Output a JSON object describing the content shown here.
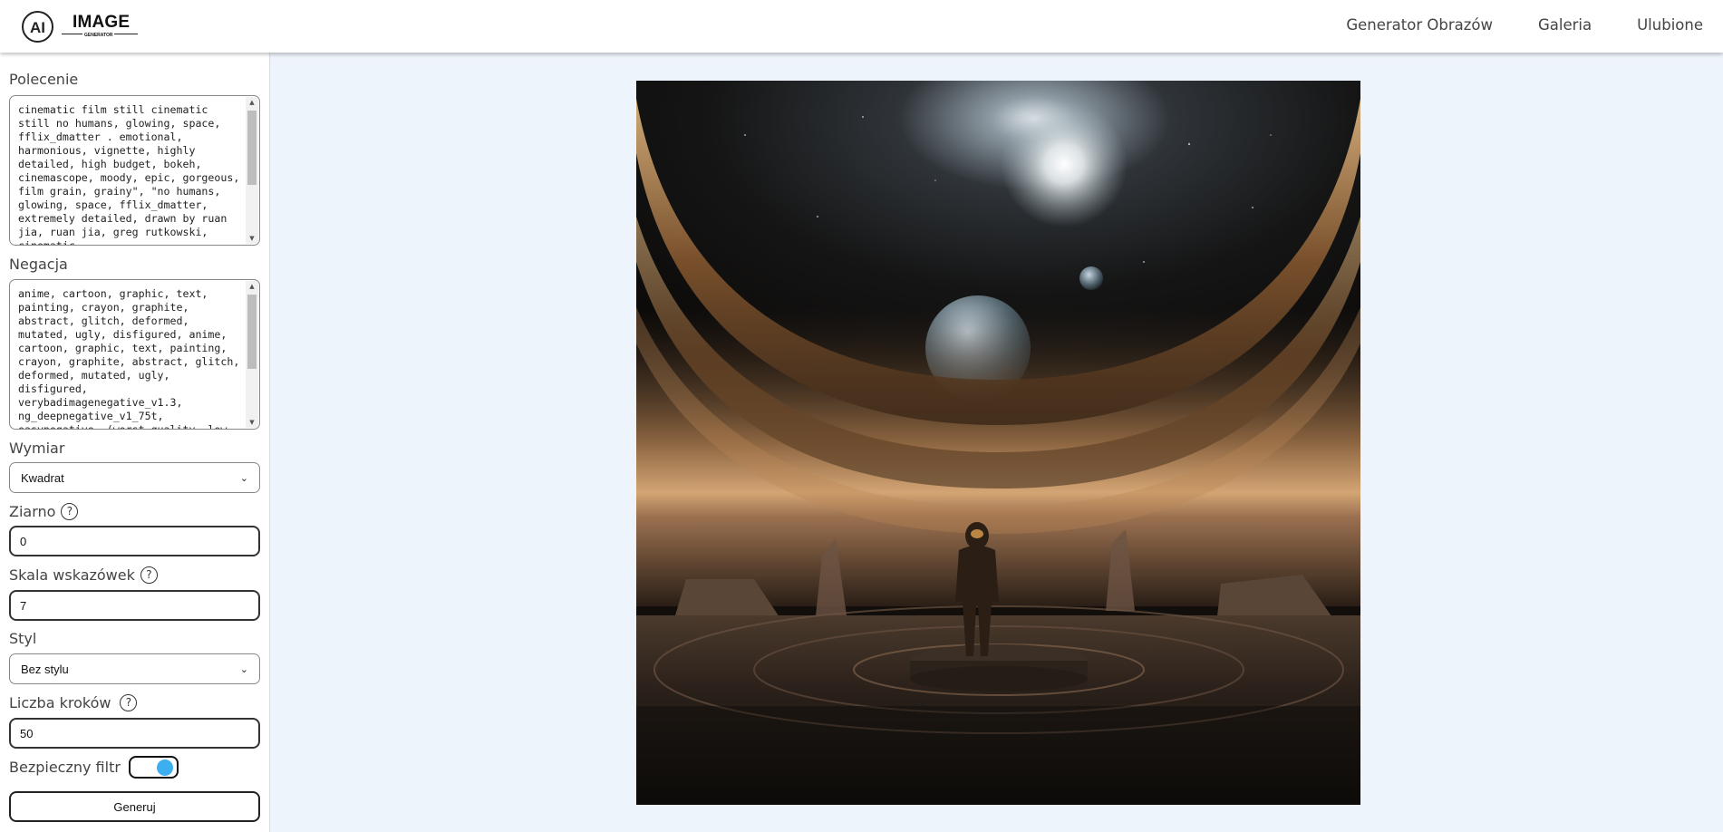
{
  "logo": {
    "mark": "AI",
    "name": "IMAGE",
    "tagline": "GENERATOR"
  },
  "nav": {
    "items": [
      "Generator Obrazów",
      "Galeria",
      "Ulubione"
    ]
  },
  "form": {
    "prompt_label": "Polecenie",
    "prompt_value": "cinematic film still cinematic still no humans, glowing, space, fflix_dmatter . emotional, harmonious, vignette, highly detailed, high budget, bokeh, cinemascope, moody, epic, gorgeous, film grain, grainy\", \"no humans, glowing, space, fflix_dmatter, extremely detailed, drawn by ruan jia, ruan jia, greg rutkowski, cinematic",
    "negative_label": "Negacja",
    "negative_value": "anime, cartoon, graphic, text, painting, crayon, graphite, abstract, glitch, deformed, mutated, ugly, disfigured, anime, cartoon, graphic, text, painting, crayon, graphite, abstract, glitch, deformed, mutated, ugly, disfigured, verybadimagenegative_v1.3, ng_deepnegative_v1_75t, easynegative, (worst quality, low",
    "size_label": "Wymiar",
    "size_value": "Kwadrat",
    "seed_label": "Ziarno",
    "seed_value": "0",
    "guidance_label": "Skala wskazówek",
    "guidance_value": "7",
    "style_label": "Styl",
    "style_value": "Bez stylu",
    "steps_label": "Liczba kroków",
    "steps_value": "50",
    "safety_label": "Bezpieczny filtr",
    "safety_on": true,
    "generate_label": "Generuj",
    "help_symbol": "?"
  },
  "icons": {
    "help": "help-circle-icon",
    "select_arrow": "chevron-down-icon"
  },
  "colors": {
    "toggle_accent": "#3daef0",
    "page_background": "#eef4fb"
  }
}
